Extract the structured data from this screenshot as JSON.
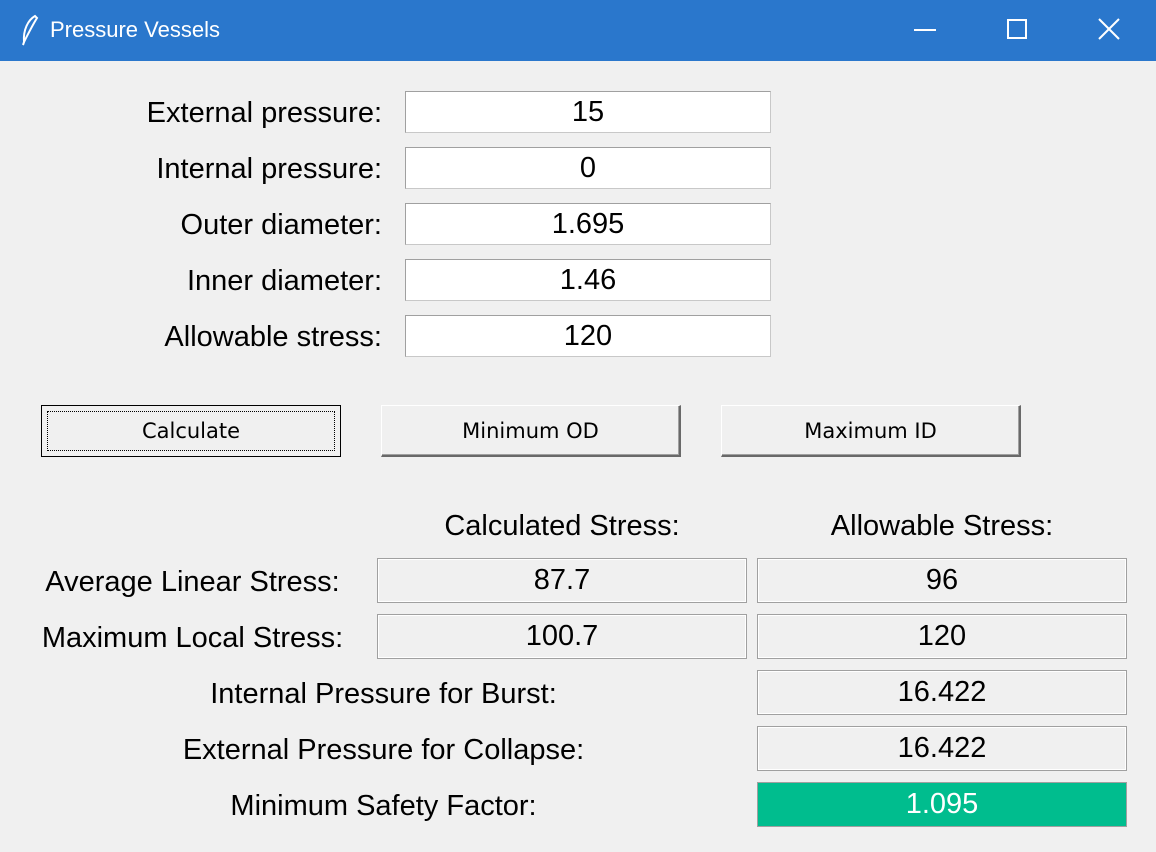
{
  "window": {
    "title": "Pressure Vessels"
  },
  "inputs": [
    {
      "label": "External pressure:",
      "value": "15"
    },
    {
      "label": "Internal pressure:",
      "value": "0"
    },
    {
      "label": "Outer diameter:",
      "value": "1.695"
    },
    {
      "label": "Inner diameter:",
      "value": "1.46"
    },
    {
      "label": "Allowable stress:",
      "value": "120"
    }
  ],
  "buttons": {
    "calculate": "Calculate",
    "minimum_od": "Minimum OD",
    "maximum_id": "Maximum ID"
  },
  "results": {
    "header_calculated": "Calculated Stress:",
    "header_allowable": "Allowable Stress:",
    "average_linear": {
      "label": "Average Linear Stress:",
      "calculated": "87.7",
      "allowable": "96"
    },
    "maximum_local": {
      "label": "Maximum Local Stress:",
      "calculated": "100.7",
      "allowable": "120"
    },
    "burst": {
      "label": "Internal Pressure for Burst:",
      "value": "16.422"
    },
    "collapse": {
      "label": "External Pressure for Collapse:",
      "value": "16.422"
    },
    "safety_factor": {
      "label": "Minimum Safety Factor:",
      "value": "1.095"
    }
  },
  "colors": {
    "titlebar": "#2a77cc",
    "safety_highlight": "#00bd8e"
  },
  "icons": [
    "feather-icon",
    "minimize-icon",
    "maximize-icon",
    "close-icon"
  ]
}
